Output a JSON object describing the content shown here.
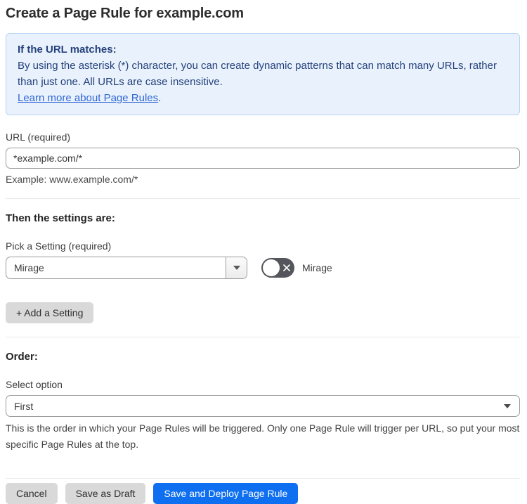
{
  "page": {
    "title": "Create a Page Rule for example.com"
  },
  "info_box": {
    "heading": "If the URL matches:",
    "body": "By using the asterisk (*) character, you can create dynamic patterns that can match many URLs, rather than just one. All URLs are case insensitive.",
    "link_label": "Learn more about Page Rules",
    "link_suffix": "."
  },
  "url_field": {
    "label": "URL (required)",
    "value": "*example.com/*",
    "helper": "Example: www.example.com/*"
  },
  "settings_section": {
    "heading": "Then the settings are:",
    "picker_label": "Pick a Setting (required)",
    "picker_value": "Mirage",
    "toggle_label": "Mirage",
    "toggle_state": "off",
    "add_setting_label": "+ Add a Setting"
  },
  "order_section": {
    "heading": "Order:",
    "select_label": "Select option",
    "select_value": "First",
    "helper": "This is the order in which your Page Rules will be triggered. Only one Page Rule will trigger per URL, so put your most specific Page Rules at the top."
  },
  "footer": {
    "cancel_label": "Cancel",
    "save_draft_label": "Save as Draft",
    "save_deploy_label": "Save and Deploy Page Rule"
  },
  "colors": {
    "accent_blue": "#0e6ff0",
    "info_bg": "#e9f2fc",
    "info_border": "#b7d4f1",
    "info_text": "#25417c",
    "link_blue": "#3066d5",
    "toggle_off_bg": "#54565b",
    "button_gray": "#d9d9d9",
    "divider": "#e9e9e9"
  }
}
